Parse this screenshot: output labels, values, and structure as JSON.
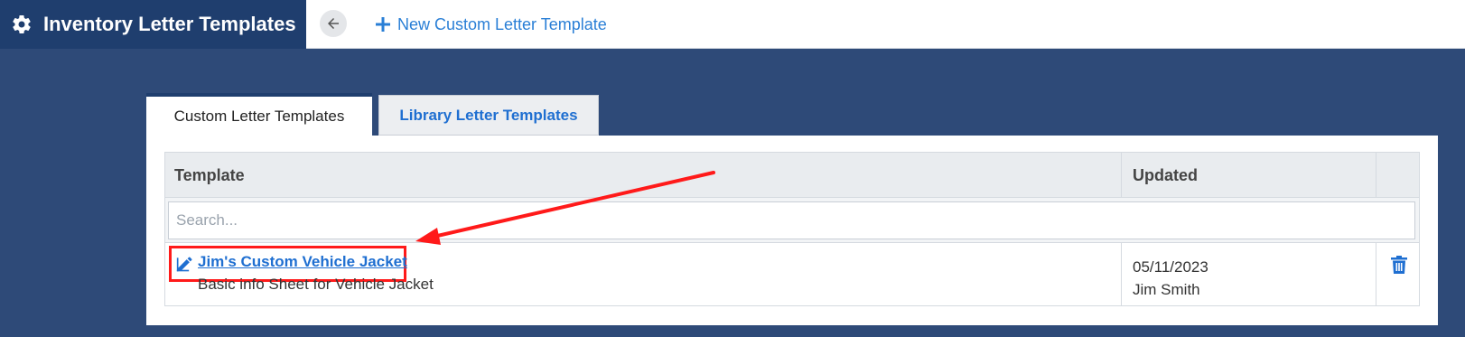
{
  "header": {
    "title": "Inventory Letter Templates",
    "new_template_label": "New Custom Letter Template",
    "icons": {
      "title": "gear-icon",
      "back": "arrow-left-icon",
      "new": "plus-icon"
    }
  },
  "tabs": [
    {
      "label": "Custom Letter Templates",
      "active": true
    },
    {
      "label": "Library Letter Templates",
      "active": false
    }
  ],
  "table": {
    "columns": [
      "Template",
      "Updated",
      ""
    ],
    "search_placeholder": "Search...",
    "rows": [
      {
        "name": "Jim's Custom Vehicle Jacket",
        "description": "Basic info Sheet for Vehicle Jacket",
        "updated_date": "05/11/2023",
        "updated_by": "Jim Smith",
        "icons": {
          "edit": "edit-icon",
          "delete": "trash-icon"
        }
      }
    ]
  },
  "colors": {
    "accent": "#1f6fd1",
    "title_bar": "#1f3e6e",
    "background": "#2e4a78",
    "annotation": "#ff1a1a"
  }
}
